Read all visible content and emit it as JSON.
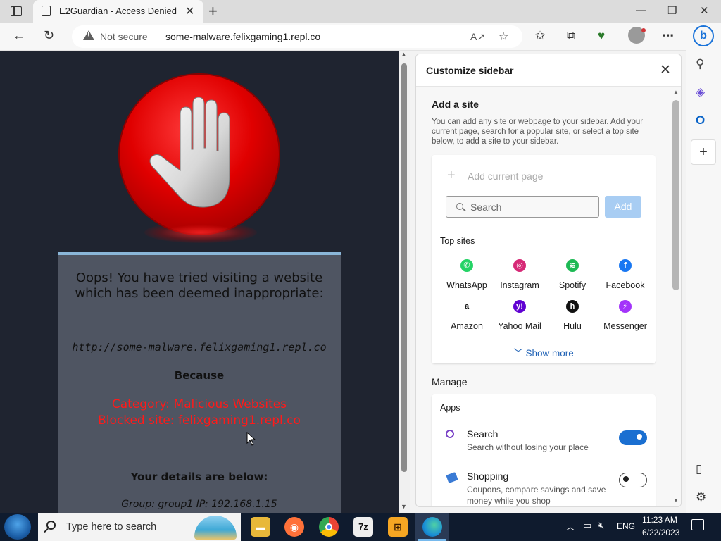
{
  "tab": {
    "title": "E2Guardian - Access Denied",
    "close": "✕",
    "new_tab": "+"
  },
  "window_controls": {
    "minimize": "—",
    "restore": "❐",
    "close": "✕"
  },
  "address_bar": {
    "security_label": "Not secure",
    "url": "some-malware.felixgaming1.repl.co"
  },
  "blocked_page": {
    "title": "Oops! You have tried visiting a website which has been deemed inappropriate:",
    "url": "http://some-malware.felixgaming1.repl.co",
    "because": "Because",
    "category": "Category: Malicious Websites",
    "blocked_site": "Blocked site: felixgaming1.repl.co",
    "details_heading": "Your details are below:",
    "group_line": "Group: group1   IP: 192.168.1.15"
  },
  "sidebar_panel": {
    "title": "Customize sidebar",
    "add_site": {
      "heading": "Add a site",
      "description": "You can add any site or webpage to your sidebar. Add your current page, search for a popular site, or select a top site below, to add a site to your sidebar.",
      "add_current_page": "Add current page",
      "search_placeholder": "Search",
      "add_button": "Add",
      "top_sites_heading": "Top sites",
      "top_sites": [
        {
          "label": "WhatsApp",
          "icon": "whatsapp-icon",
          "color": "#25d366",
          "glyph": "✆"
        },
        {
          "label": "Instagram",
          "icon": "instagram-icon",
          "color": "#d62976",
          "glyph": "◎"
        },
        {
          "label": "Spotify",
          "icon": "spotify-icon",
          "color": "#1db954",
          "glyph": "≋"
        },
        {
          "label": "Facebook",
          "icon": "facebook-icon",
          "color": "#1877f2",
          "glyph": "f"
        },
        {
          "label": "Amazon",
          "icon": "amazon-icon",
          "color": "#ffffff",
          "glyph": "a"
        },
        {
          "label": "Yahoo Mail",
          "icon": "yahoo-mail-icon",
          "color": "#6001d2",
          "glyph": "y!"
        },
        {
          "label": "Hulu",
          "icon": "hulu-icon",
          "color": "#111111",
          "glyph": "h"
        },
        {
          "label": "Messenger",
          "icon": "messenger-icon",
          "color": "#a334fa",
          "glyph": "⚡"
        }
      ],
      "show_more": "Show more"
    },
    "manage": {
      "heading": "Manage",
      "apps_heading": "Apps",
      "apps": [
        {
          "name": "Search",
          "description": "Search without losing your place",
          "enabled": true
        },
        {
          "name": "Shopping",
          "description": "Coupons, compare savings and save money while you shop",
          "enabled": false
        }
      ]
    }
  },
  "taskbar": {
    "search_placeholder": "Type here to search",
    "language": "ENG",
    "time": "11:23 AM",
    "date": "6/22/2023"
  },
  "colors": {
    "page_background": "#1f2430",
    "stop_sign_red": "#e00000",
    "blocked_text": "#ff1a1a",
    "toggle_on": "#1a6fd1",
    "link": "#2062b5"
  }
}
